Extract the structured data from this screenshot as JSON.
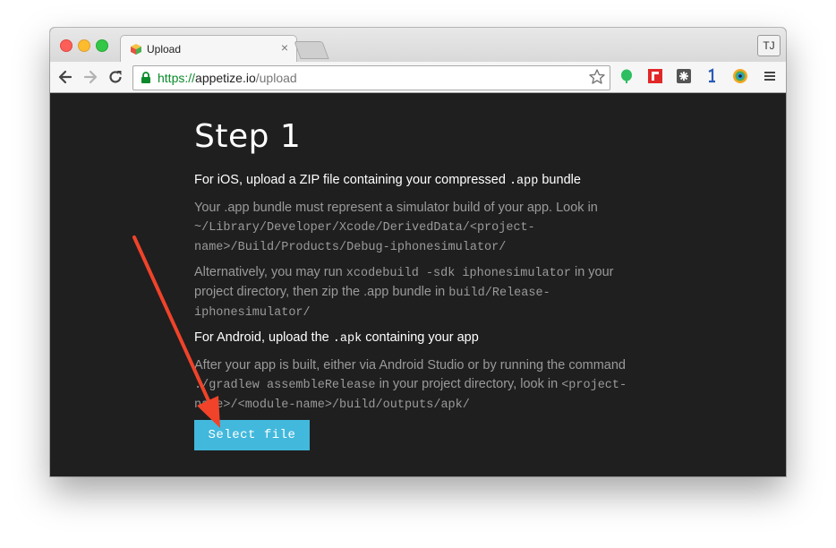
{
  "browser": {
    "tab": {
      "title": "Upload"
    },
    "address": {
      "scheme": "https://",
      "host": "appetize.io",
      "path": "/upload"
    },
    "profile_initials": "TJ",
    "extension_icons": [
      "evernote-icon",
      "flipboard-icon",
      "puzzle-icon",
      "1password-icon",
      "chrome-color-icon"
    ],
    "menu_icon": "hamburger-menu-icon"
  },
  "page": {
    "heading": "Step 1",
    "ios": {
      "line_pre": "For iOS, upload a ZIP file containing your compressed ",
      "line_code": ".app",
      "line_post": " bundle",
      "p1_text": "Your .app bundle must represent a simulator build of your app. Look in ",
      "p1_code": "~/Library/Developer/Xcode/DerivedData/<project-name>/Build/Products/Debug-iphonesimulator/",
      "p2_text1": "Alternatively, you may run ",
      "p2_code1": "xcodebuild -sdk iphonesimulator",
      "p2_text2": " in your project directory, then zip the .app bundle in ",
      "p2_code2": "build/Release-iphonesimulator/"
    },
    "android": {
      "line_pre": "For Android, upload the ",
      "line_code": ".apk",
      "line_post": " containing your app",
      "p_text1": "After your app is built, either via Android Studio or by running the command ",
      "p_code1": "./gradlew assembleRelease",
      "p_text2": " in your project directory, look in ",
      "p_code2": "<project-name>/<module-name>/build/outputs/apk/"
    },
    "select_button": "Select file"
  },
  "colors": {
    "page_bg": "#1f1f1f",
    "button_bg": "#42b8dc",
    "arrow": "#f0432a",
    "secure_green": "#0a8a2a"
  }
}
